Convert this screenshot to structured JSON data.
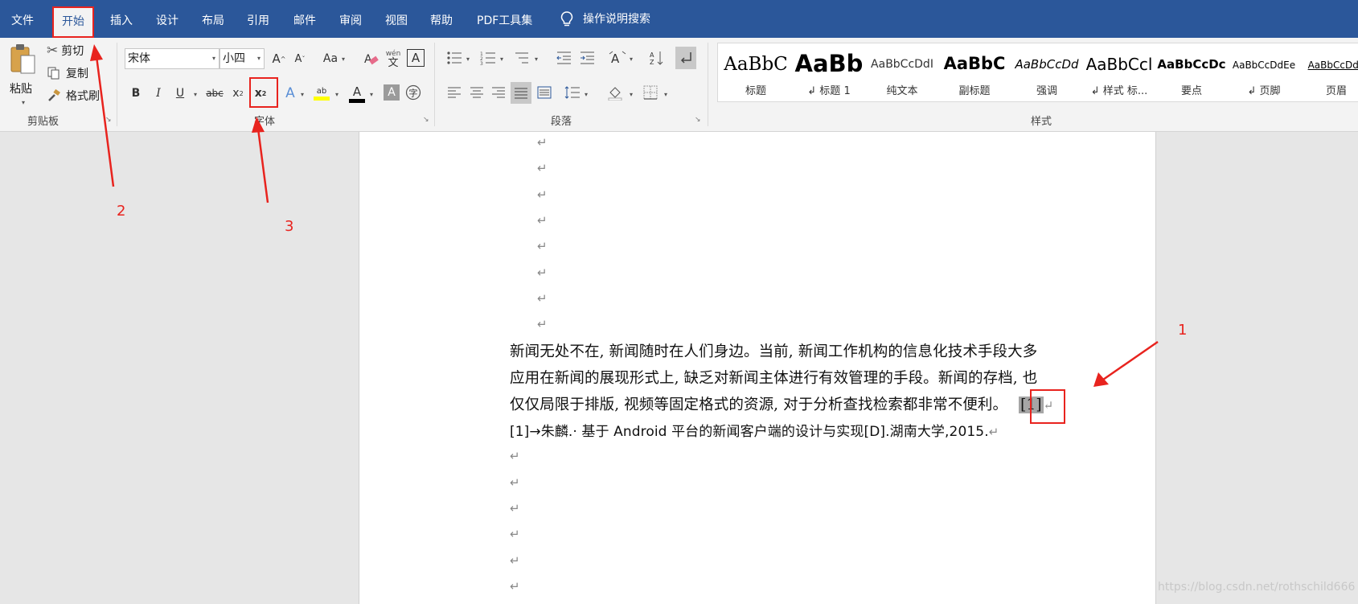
{
  "menubar": {
    "items": [
      "文件",
      "开始",
      "插入",
      "设计",
      "布局",
      "引用",
      "邮件",
      "审阅",
      "视图",
      "帮助",
      "PDF工具集"
    ],
    "active_item": "开始",
    "tell_me": "操作说明搜索"
  },
  "ribbon": {
    "clipboard": {
      "paste": "粘贴",
      "cut": "剪切",
      "copy": "复制",
      "format_painter": "格式刷",
      "group_label": "剪贴板"
    },
    "font": {
      "font_name": "宋体",
      "font_size": "小四",
      "case_label": "Aa",
      "phonetic_label": "wén",
      "group_label": "字体"
    },
    "paragraph": {
      "group_label": "段落"
    },
    "styles": {
      "group_label": "样式",
      "items": [
        {
          "preview": "AaBbC",
          "name": "标题"
        },
        {
          "preview": "AaBb",
          "name": "↲ 标题 1"
        },
        {
          "preview": "AaBbCcDdI",
          "name": "纯文本"
        },
        {
          "preview": "AaBbC",
          "name": "副标题"
        },
        {
          "preview": "AaBbCcDd",
          "name": "强调"
        },
        {
          "preview": "AaBbCcl",
          "name": "↲ 样式 标..."
        },
        {
          "preview": "AaBbCcDc",
          "name": "要点"
        },
        {
          "preview": "AaBbCcDdEe",
          "name": "↲ 页脚"
        },
        {
          "preview": "AaBbCcDdE",
          "name": "页眉"
        }
      ]
    }
  },
  "document": {
    "para_mark": "↵",
    "lines": [
      "新闻无处不在, 新闻随时在人们身边。当前, 新闻工作机构的信息化技术手段大多",
      "应用在新闻的展现形式上, 缺乏对新闻主体进行有效管理的手段。新闻的存档, 也",
      "仅仅局限于排版, 视频等固定格式的资源, 对于分析查找检索都非常不便利。"
    ],
    "citation": "[1]",
    "reference": "[1]→朱麟.· 基于 Android 平台的新闻客户端的设计与实现[D].湖南大学,2015."
  },
  "annotations": {
    "labels": [
      "1",
      "2",
      "3"
    ],
    "color": "#e8231e"
  },
  "watermark": "https://blog.csdn.net/rothschild666",
  "colors": {
    "ribbon_blue": "#2b579a",
    "ribbon_bg": "#f3f3f3",
    "annotation_red": "#e8231e"
  }
}
